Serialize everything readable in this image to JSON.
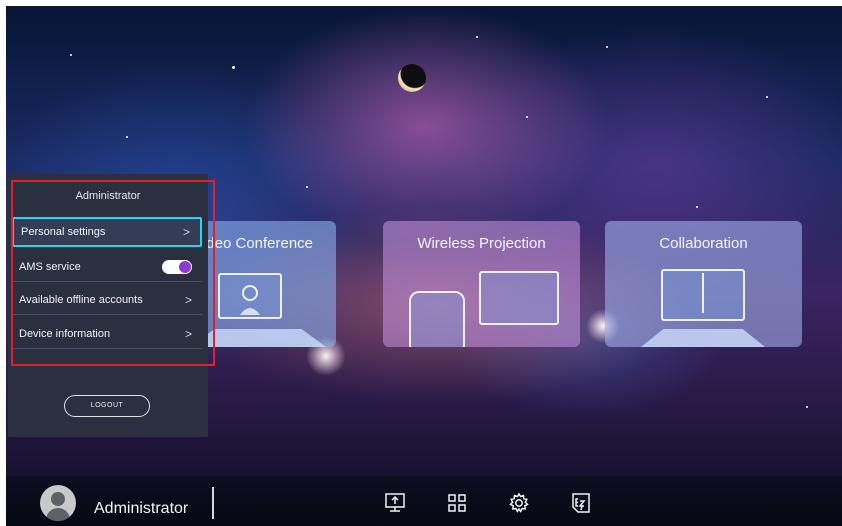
{
  "tiles": {
    "video": {
      "title": "ideo Conference"
    },
    "wireless": {
      "title": "Wireless Projection"
    },
    "collab": {
      "title": "Collaboration"
    }
  },
  "admin_panel": {
    "title": "Administrator",
    "items": [
      {
        "label": "Personal settings",
        "control": "chevron",
        "selected": true
      },
      {
        "label": "AMS service",
        "control": "toggle",
        "toggle_on": true
      },
      {
        "label": "Available offline accounts",
        "control": "chevron"
      },
      {
        "label": "Device information",
        "control": "chevron"
      }
    ],
    "chevron": ">",
    "logout_label": "LOGOUT"
  },
  "bottom_bar": {
    "user_name": "Administrator",
    "icons": [
      "screen-share-icon",
      "apps-grid-icon",
      "settings-gear-icon",
      "ez-write-icon"
    ]
  },
  "colors": {
    "selection_outline": "#22d8ee",
    "toggle_accent": "#8c3bd8",
    "highlight_box": "#e0202a",
    "panel_bg": "#2b3040"
  }
}
